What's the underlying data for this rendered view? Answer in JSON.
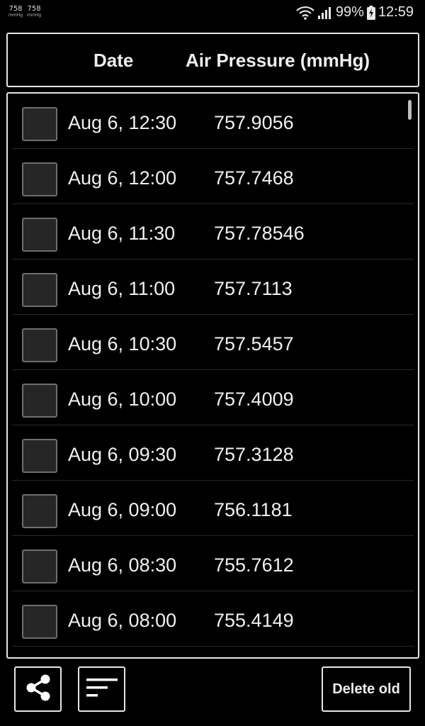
{
  "status_bar": {
    "notifications": [
      {
        "value": "758",
        "unit": "mmHg"
      },
      {
        "value": "758",
        "unit": "mmHg"
      }
    ],
    "battery": "99%",
    "time": "12:59"
  },
  "header": {
    "date_label": "Date",
    "pressure_label": "Air Pressure (mmHg)"
  },
  "readings": [
    {
      "date": "Aug 6, 12:30",
      "value": "757.9056"
    },
    {
      "date": "Aug 6, 12:00",
      "value": "757.7468"
    },
    {
      "date": "Aug 6, 11:30",
      "value": "757.78546"
    },
    {
      "date": "Aug 6, 11:00",
      "value": "757.7113"
    },
    {
      "date": "Aug 6, 10:30",
      "value": "757.5457"
    },
    {
      "date": "Aug 6, 10:00",
      "value": "757.4009"
    },
    {
      "date": "Aug 6, 09:30",
      "value": "757.3128"
    },
    {
      "date": "Aug 6, 09:00",
      "value": "756.1181"
    },
    {
      "date": "Aug 6, 08:30",
      "value": "755.7612"
    },
    {
      "date": "Aug 6, 08:00",
      "value": "755.4149"
    },
    {
      "date": "",
      "value": ""
    }
  ],
  "toolbar": {
    "share_icon": "share-icon",
    "sort_icon": "sort-icon",
    "delete_label": "Delete old"
  }
}
